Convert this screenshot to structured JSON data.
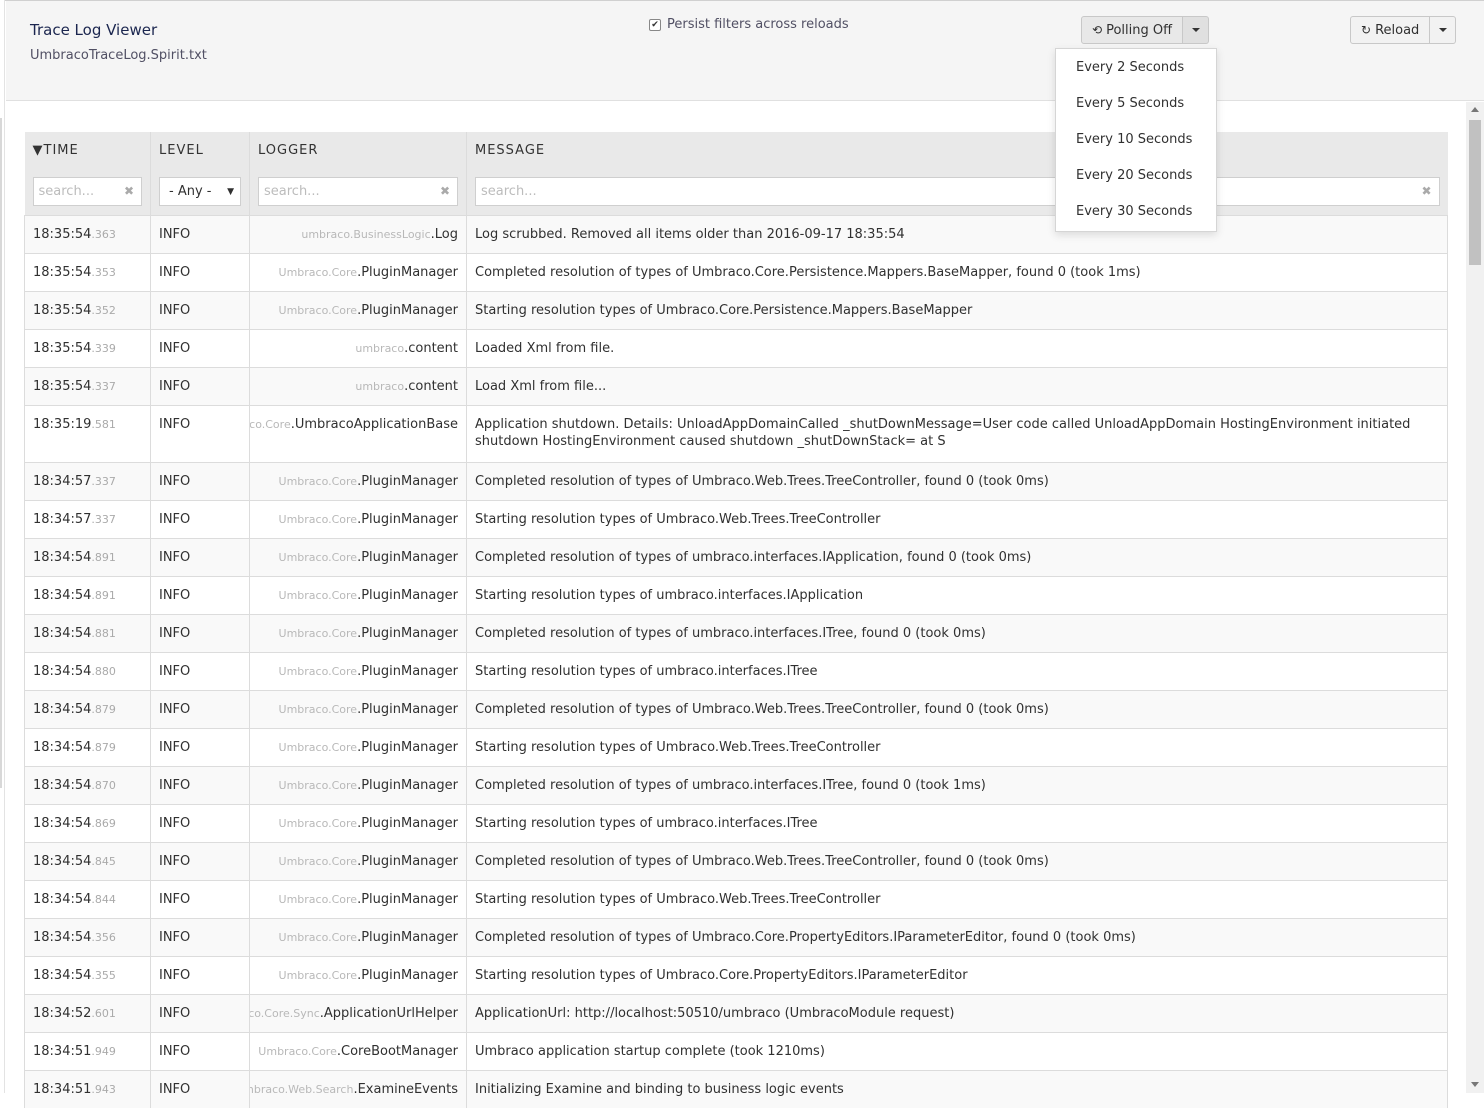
{
  "header": {
    "title": "Trace Log Viewer",
    "subtitle": "UmbracoTraceLog.Spirit.txt",
    "persist_label": "Persist filters across reloads",
    "polling_label": "Polling Off",
    "reload_label": "Reload"
  },
  "polling_menu": [
    "Every 2 Seconds",
    "Every 5 Seconds",
    "Every 10 Seconds",
    "Every 20 Seconds",
    "Every 30 Seconds"
  ],
  "table": {
    "columns": [
      {
        "label": "TIME",
        "sort": "▼"
      },
      {
        "label": "LEVEL"
      },
      {
        "label": "LOGGER"
      },
      {
        "label": "MESSAGE"
      }
    ],
    "filters": {
      "time_placeholder": "search...",
      "level_value": "- Any -",
      "logger_placeholder": "search...",
      "message_placeholder": "search...",
      "clear_glyph": "✖"
    },
    "rows": [
      {
        "time": "18:35:54",
        "ms": ".363",
        "level": "INFO",
        "logger_ns": "umbraco.BusinessLogic",
        "logger_name": ".Log",
        "message": "Log scrubbed. Removed all items older than 2016-09-17 18:35:54"
      },
      {
        "time": "18:35:54",
        "ms": ".353",
        "level": "INFO",
        "logger_ns": "Umbraco.Core",
        "logger_name": ".PluginManager",
        "message": "Completed resolution of types of Umbraco.Core.Persistence.Mappers.BaseMapper, found 0 (took 1ms)"
      },
      {
        "time": "18:35:54",
        "ms": ".352",
        "level": "INFO",
        "logger_ns": "Umbraco.Core",
        "logger_name": ".PluginManager",
        "message": "Starting resolution types of Umbraco.Core.Persistence.Mappers.BaseMapper"
      },
      {
        "time": "18:35:54",
        "ms": ".339",
        "level": "INFO",
        "logger_ns": "umbraco",
        "logger_name": ".content",
        "message": "Loaded Xml from file."
      },
      {
        "time": "18:35:54",
        "ms": ".337",
        "level": "INFO",
        "logger_ns": "umbraco",
        "logger_name": ".content",
        "message": "Load Xml from file..."
      },
      {
        "time": "18:35:19",
        "ms": ".581",
        "level": "INFO",
        "logger_ns": "co.Core",
        "logger_name": ".UmbracoApplicationBase",
        "message": "Application shutdown. Details: UnloadAppDomainCalled _shutDownMessage=User code called UnloadAppDomain HostingEnvironment initiated shutdown HostingEnvironment caused shutdown _shutDownStack= at S",
        "tall": true
      },
      {
        "time": "18:34:57",
        "ms": ".337",
        "level": "INFO",
        "logger_ns": "Umbraco.Core",
        "logger_name": ".PluginManager",
        "message": "Completed resolution of types of Umbraco.Web.Trees.TreeController, found 0 (took 0ms)"
      },
      {
        "time": "18:34:57",
        "ms": ".337",
        "level": "INFO",
        "logger_ns": "Umbraco.Core",
        "logger_name": ".PluginManager",
        "message": "Starting resolution types of Umbraco.Web.Trees.TreeController"
      },
      {
        "time": "18:34:54",
        "ms": ".891",
        "level": "INFO",
        "logger_ns": "Umbraco.Core",
        "logger_name": ".PluginManager",
        "message": "Completed resolution of types of umbraco.interfaces.IApplication, found 0 (took 0ms)"
      },
      {
        "time": "18:34:54",
        "ms": ".891",
        "level": "INFO",
        "logger_ns": "Umbraco.Core",
        "logger_name": ".PluginManager",
        "message": "Starting resolution types of umbraco.interfaces.IApplication"
      },
      {
        "time": "18:34:54",
        "ms": ".881",
        "level": "INFO",
        "logger_ns": "Umbraco.Core",
        "logger_name": ".PluginManager",
        "message": "Completed resolution of types of umbraco.interfaces.ITree, found 0 (took 0ms)"
      },
      {
        "time": "18:34:54",
        "ms": ".880",
        "level": "INFO",
        "logger_ns": "Umbraco.Core",
        "logger_name": ".PluginManager",
        "message": "Starting resolution types of umbraco.interfaces.ITree"
      },
      {
        "time": "18:34:54",
        "ms": ".879",
        "level": "INFO",
        "logger_ns": "Umbraco.Core",
        "logger_name": ".PluginManager",
        "message": "Completed resolution of types of Umbraco.Web.Trees.TreeController, found 0 (took 0ms)"
      },
      {
        "time": "18:34:54",
        "ms": ".879",
        "level": "INFO",
        "logger_ns": "Umbraco.Core",
        "logger_name": ".PluginManager",
        "message": "Starting resolution types of Umbraco.Web.Trees.TreeController"
      },
      {
        "time": "18:34:54",
        "ms": ".870",
        "level": "INFO",
        "logger_ns": "Umbraco.Core",
        "logger_name": ".PluginManager",
        "message": "Completed resolution of types of umbraco.interfaces.ITree, found 0 (took 1ms)"
      },
      {
        "time": "18:34:54",
        "ms": ".869",
        "level": "INFO",
        "logger_ns": "Umbraco.Core",
        "logger_name": ".PluginManager",
        "message": "Starting resolution types of umbraco.interfaces.ITree"
      },
      {
        "time": "18:34:54",
        "ms": ".845",
        "level": "INFO",
        "logger_ns": "Umbraco.Core",
        "logger_name": ".PluginManager",
        "message": "Completed resolution of types of Umbraco.Web.Trees.TreeController, found 0 (took 0ms)"
      },
      {
        "time": "18:34:54",
        "ms": ".844",
        "level": "INFO",
        "logger_ns": "Umbraco.Core",
        "logger_name": ".PluginManager",
        "message": "Starting resolution types of Umbraco.Web.Trees.TreeController"
      },
      {
        "time": "18:34:54",
        "ms": ".356",
        "level": "INFO",
        "logger_ns": "Umbraco.Core",
        "logger_name": ".PluginManager",
        "message": "Completed resolution of types of Umbraco.Core.PropertyEditors.IParameterEditor, found 0 (took 0ms)"
      },
      {
        "time": "18:34:54",
        "ms": ".355",
        "level": "INFO",
        "logger_ns": "Umbraco.Core",
        "logger_name": ".PluginManager",
        "message": "Starting resolution types of Umbraco.Core.PropertyEditors.IParameterEditor"
      },
      {
        "time": "18:34:52",
        "ms": ".601",
        "level": "INFO",
        "logger_ns": "co.Core.Sync",
        "logger_name": ".ApplicationUrlHelper",
        "message": "ApplicationUrl: http://localhost:50510/umbraco (UmbracoModule request)"
      },
      {
        "time": "18:34:51",
        "ms": ".949",
        "level": "INFO",
        "logger_ns": "Umbraco.Core",
        "logger_name": ".CoreBootManager",
        "message": "Umbraco application startup complete (took 1210ms)"
      },
      {
        "time": "18:34:51",
        "ms": ".943",
        "level": "INFO",
        "logger_ns": "nbraco.Web.Search",
        "logger_name": ".ExamineEvents",
        "message": "Initializing Examine and binding to business logic events"
      }
    ]
  }
}
